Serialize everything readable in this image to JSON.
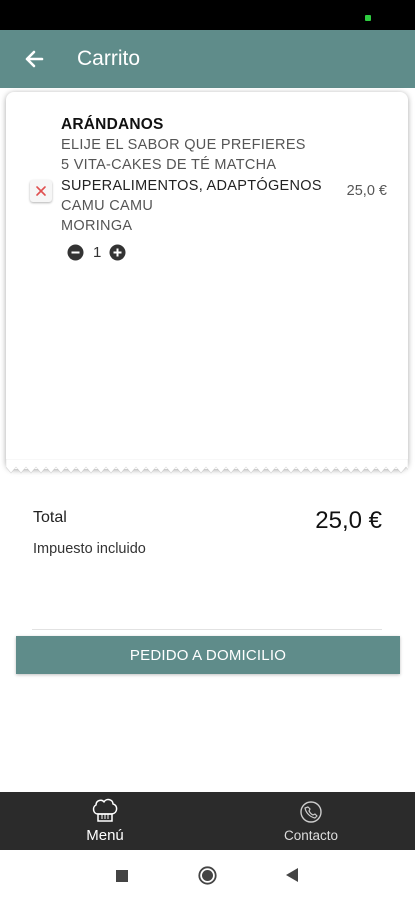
{
  "header": {
    "title": "Carrito"
  },
  "cart": {
    "item_name": "ARÁNDANOS",
    "options": [
      "ELIJE EL SABOR QUE PREFIERES",
      "5 VITA-CAKES DE TÉ MATCHA",
      "SUPERALIMENTOS, ADAPTÓGENOS",
      "CAMU CAMU",
      "MORINGA"
    ],
    "price": "25,0 €",
    "quantity": "1"
  },
  "summary": {
    "total_label": "Total",
    "total_value": "25,0 €",
    "tax_note": "Impuesto incluido"
  },
  "actions": {
    "order_button": "PEDIDO A DOMICILIO"
  },
  "bottom_nav": {
    "menu_label": "Menú",
    "contact_label": "Contacto"
  },
  "colors": {
    "accent": "#5f8c8a",
    "nav_background": "#2b2b2b",
    "remove": "#e05050"
  },
  "icons": {
    "back": "arrow-left-icon",
    "remove": "close-icon",
    "decrease": "minus-circle-icon",
    "increase": "plus-circle-icon",
    "menu": "chef-hat-icon",
    "contact": "contact-icon"
  }
}
